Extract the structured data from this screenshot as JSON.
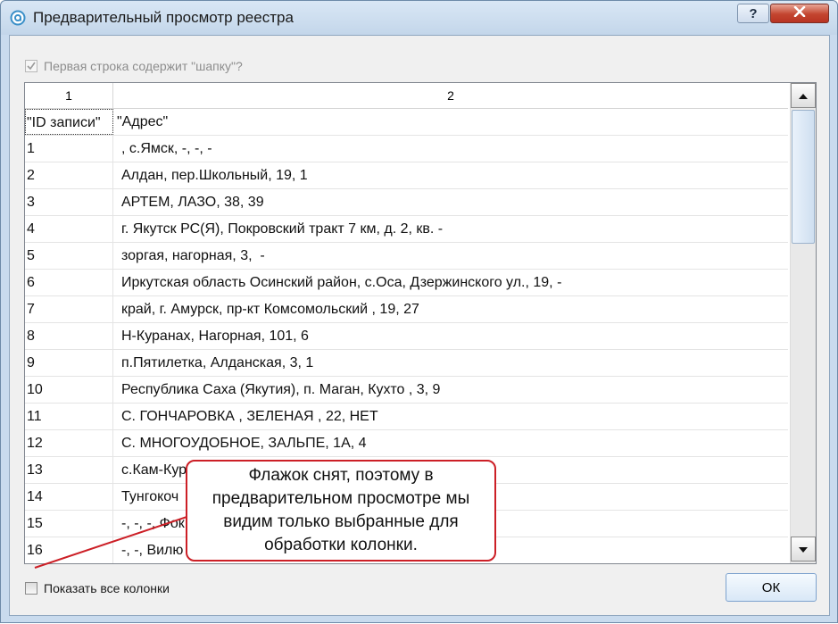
{
  "window": {
    "title": "Предварительный просмотр реестра",
    "help_label": "?",
    "close_icon": "close-icon",
    "app_icon": "app-logo-icon"
  },
  "options": {
    "header_checkbox_label": "Первая строка содержит \"шапку\"?",
    "header_checkbox_checked": true,
    "header_checkbox_enabled": false,
    "show_all_label": "Показать все колонки",
    "show_all_checked": false
  },
  "grid": {
    "columns": [
      "1",
      "2"
    ],
    "rows": [
      [
        "\"ID записи\"",
        "\"Адрес\""
      ],
      [
        "1",
        ", с.Ямск, -, -, -"
      ],
      [
        "2",
        "Алдан, пер.Школьный, 19, 1"
      ],
      [
        "3",
        "АРТЕМ, ЛАЗО, 38, 39"
      ],
      [
        "4",
        "г. Якутск РС(Я), Покровский тракт 7 км, д. 2, кв. -"
      ],
      [
        "5",
        "зоргая, нагорная, 3,  -"
      ],
      [
        "6",
        "Иркутская область Осинский район, с.Оса, Дзержинского ул., 19, -"
      ],
      [
        "7",
        "край, г. Амурск, пр-кт Комсомольский , 19, 27"
      ],
      [
        "8",
        "Н-Куранах, Нагорная, 101, 6"
      ],
      [
        "9",
        "п.Пятилетка, Алданская, 3, 1"
      ],
      [
        "10",
        "Республика Саха (Якутия), п. Маган, Кухто , 3, 9"
      ],
      [
        "11",
        "С. ГОНЧАРОВКА , ЗЕЛЕНАЯ , 22, НЕТ"
      ],
      [
        "12",
        "С. МНОГОУДОБНОЕ, ЗАЛЬПЕ, 1А, 4"
      ],
      [
        "13",
        "с.Кам-Кур"
      ],
      [
        "14",
        "Тунгокоч"
      ],
      [
        "15",
        "-, -, -, Фок"
      ],
      [
        "16",
        "-, -, Вилю"
      ]
    ],
    "scrollbar": {
      "up_icon": "arrow-up-icon",
      "down_icon": "arrow-down-icon"
    }
  },
  "buttons": {
    "ok_label": "ОК"
  },
  "callout": {
    "lines": [
      "Флажок снят, поэтому в",
      "предварительном просмотре мы",
      "видим только выбранные для",
      "обработки колонки."
    ]
  },
  "colors": {
    "callout_border": "#cc1f26",
    "close_button": "#c3452f",
    "titlebar": "#c9dbee"
  }
}
